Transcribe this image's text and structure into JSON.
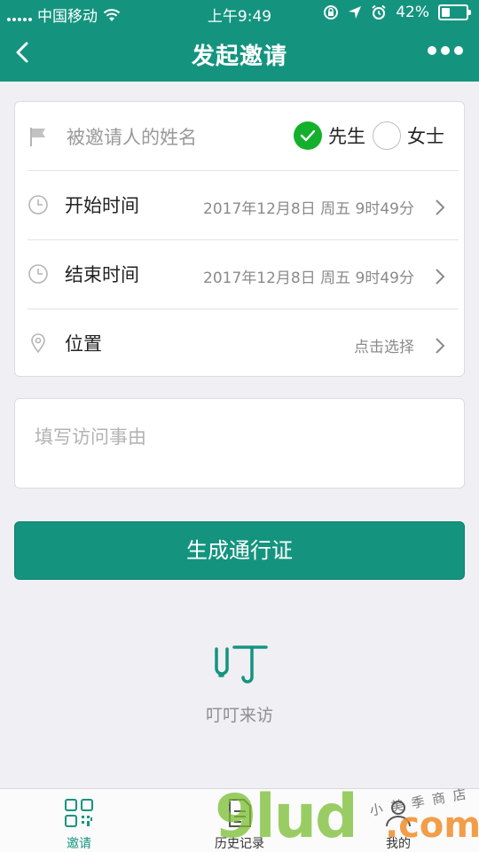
{
  "status_bar": {
    "carrier": "中国移动",
    "time": "上午9:49",
    "battery": "42%",
    "battery_level": 0.42
  },
  "nav": {
    "title": "发起邀请",
    "back_icon": "chevron-left-icon",
    "more_icon": "more-dots-icon"
  },
  "form": {
    "name_placeholder": "被邀请人的姓名",
    "gender_options": [
      {
        "label": "先生",
        "checked": true
      },
      {
        "label": "女士",
        "checked": false
      }
    ],
    "start": {
      "label": "开始时间",
      "value": "2017年12月8日 周五 9时49分"
    },
    "end": {
      "label": "结束时间",
      "value": "2017年12月8日 周五 9时49分"
    },
    "location": {
      "label": "位置",
      "value": "点击选择"
    }
  },
  "reason_placeholder": "填写访问事由",
  "submit_label": "生成通行证",
  "brand": {
    "name": "叮叮来访"
  },
  "tabs": [
    {
      "label": "邀请",
      "icon": "qr-code-icon",
      "active": true
    },
    {
      "label": "历史记录",
      "icon": "document-icon",
      "active": false
    },
    {
      "label": "我的",
      "icon": "person-icon",
      "active": false
    }
  ],
  "watermark": {
    "main": "9lud",
    "suffix": ".com",
    "small": "小 美 季 商 店"
  },
  "colors": {
    "primary": "#14947f",
    "check": "#14b02c",
    "background": "#efeff4"
  }
}
